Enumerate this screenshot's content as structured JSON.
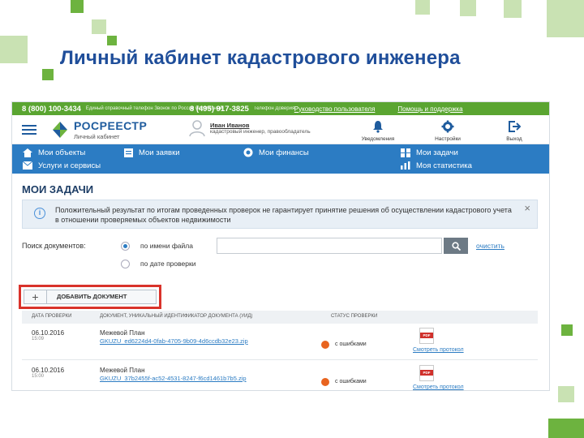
{
  "slide": {
    "title": "Личный кабинет кадастрового инженера"
  },
  "colors": {
    "accent_green": "#6db33f",
    "brand_blue": "#1f5c9e",
    "nav_blue": "#2c7cc3",
    "topbar_green": "#5aa531",
    "highlight_red": "#d9332b",
    "status_orange": "#e8641f"
  },
  "topbar": {
    "phone1": "8 (800) 100-3434",
    "phone1_note": "Единый справочный телефон Звонок по России бесплатный",
    "phone2": "8 (495) 917-3825",
    "phone2_note": "Телефон Доверия",
    "guide_link": "Руководство пользователя",
    "help_link": "Помощь и поддержка"
  },
  "header": {
    "logo_name": "РОСРЕЕСТР",
    "logo_sub": "Личный кабинет",
    "user_name": "Иван Иванов",
    "user_role": "кадастровый инженер, правообладатель",
    "notifications_label": "Уведомления",
    "settings_label": "Настройки",
    "logout_label": "Выход"
  },
  "nav": {
    "my_objects": "Мои объекты",
    "my_requests": "Мои заявки",
    "my_finances": "Мои финансы",
    "my_tasks": "Мои задачи",
    "services": "Услуги и сервисы",
    "my_stats": "Моя статистика"
  },
  "main": {
    "page_title": "МОИ ЗАДАЧИ",
    "info_text": "Положительный результат по итогам проведенных проверок не гарантирует принятие решения об осуществлении кадастрового учета в отношении проверяемых объектов недвижимости",
    "search_label": "Поиск документов:",
    "radio_by_name": "по имени файла",
    "radio_by_date": "по дате проверки",
    "search_placeholder": "",
    "clear_label": "очистить",
    "add_button_label": "ДОБАВИТЬ ДОКУМЕНТ",
    "columns": {
      "date": "ДАТА ПРОВЕРКИ",
      "doc": "ДОКУМЕНТ, УНИКАЛЬНЫЙ ИДЕНТИФИКАТОР ДОКУМЕНТА (УИД)",
      "status": "СТАТУС ПРОВЕРКИ"
    },
    "rows": [
      {
        "date": "06.10.2016",
        "time": "15:09",
        "doc": "Межевой План",
        "uid": "GKUZU_ed6224d4-0fab-4705-9b09-4d6ccdb32e23.zip",
        "status": "с ошибками",
        "report": "Смотреть протокол"
      },
      {
        "date": "06.10.2016",
        "time": "15:00",
        "doc": "Межевой План",
        "uid": "GKUZU_37b2455f-ac52-4531-8247-f6cd1461b7b5.zip",
        "status": "с ошибками",
        "report": "Смотреть протокол"
      }
    ]
  }
}
